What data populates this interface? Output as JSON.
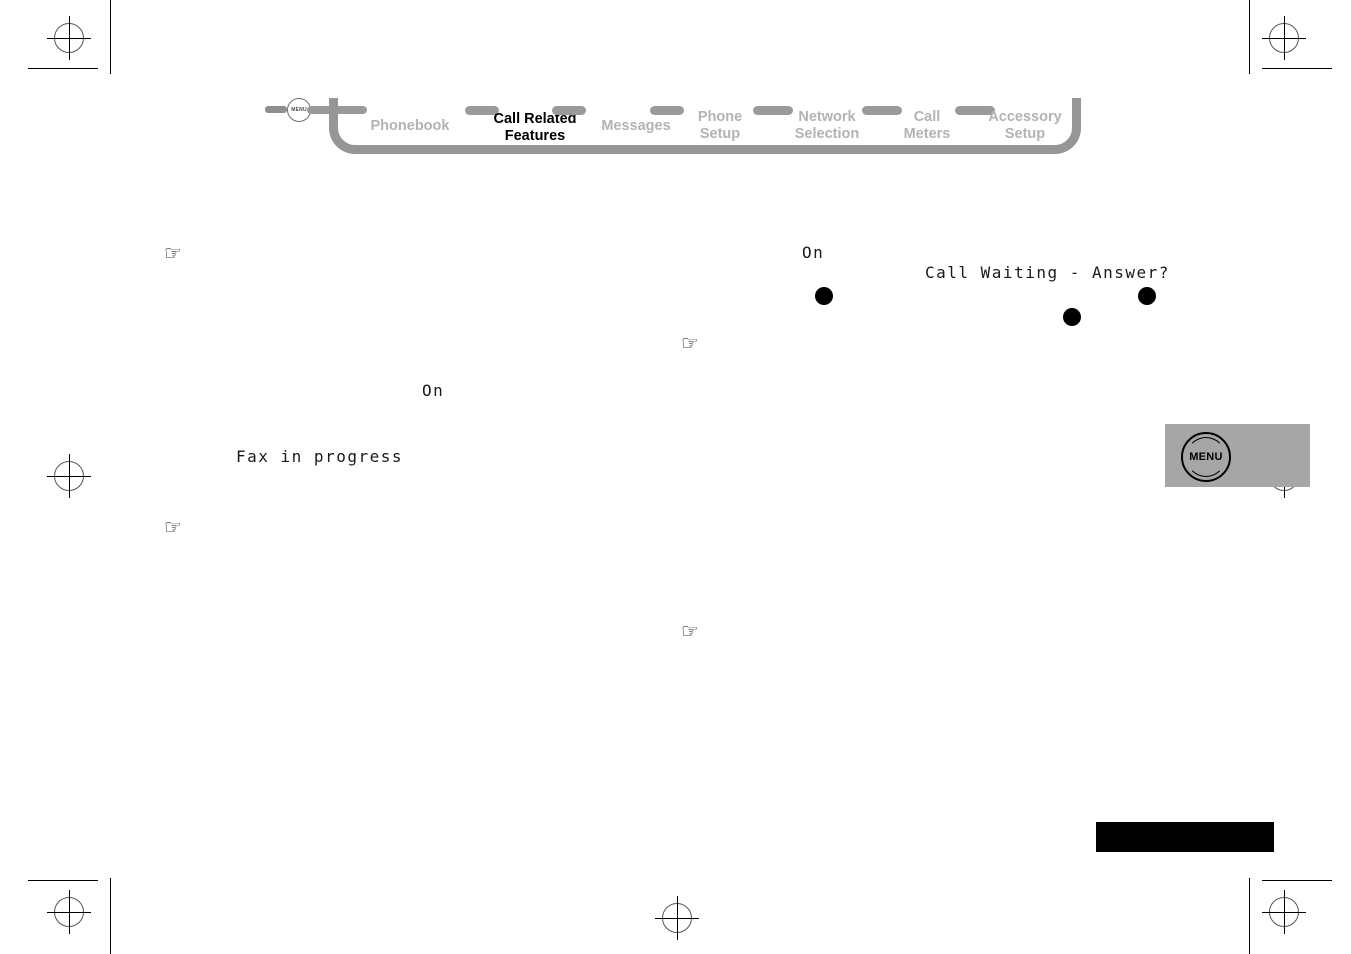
{
  "document": {
    "type": "printed-manual-page",
    "page_background": "#ffffff"
  },
  "nav": {
    "menu_icon_label": "MENU",
    "items": [
      {
        "label": "Phonebook",
        "active": false
      },
      {
        "label": "Call Related\nFeatures",
        "active": true
      },
      {
        "label": "Messages",
        "active": false
      },
      {
        "label": "Phone\nSetup",
        "active": false
      },
      {
        "label": "Network\nSelection",
        "active": false
      },
      {
        "label": "Call\nMeters",
        "active": false
      },
      {
        "label": "Accessory\nSetup",
        "active": false
      }
    ],
    "track_color": "#969696",
    "inactive_color": "#b3b3b3",
    "active_color": "#000000"
  },
  "content": {
    "hand_icon": "☞",
    "lcd_texts": [
      {
        "text": "On"
      },
      {
        "text": "Fax in progress"
      },
      {
        "text": "On"
      },
      {
        "text": "Call Waiting - Answer?"
      }
    ]
  },
  "callout": {
    "menu_button_label": "MENU",
    "box_color": "#a6a6a6"
  }
}
